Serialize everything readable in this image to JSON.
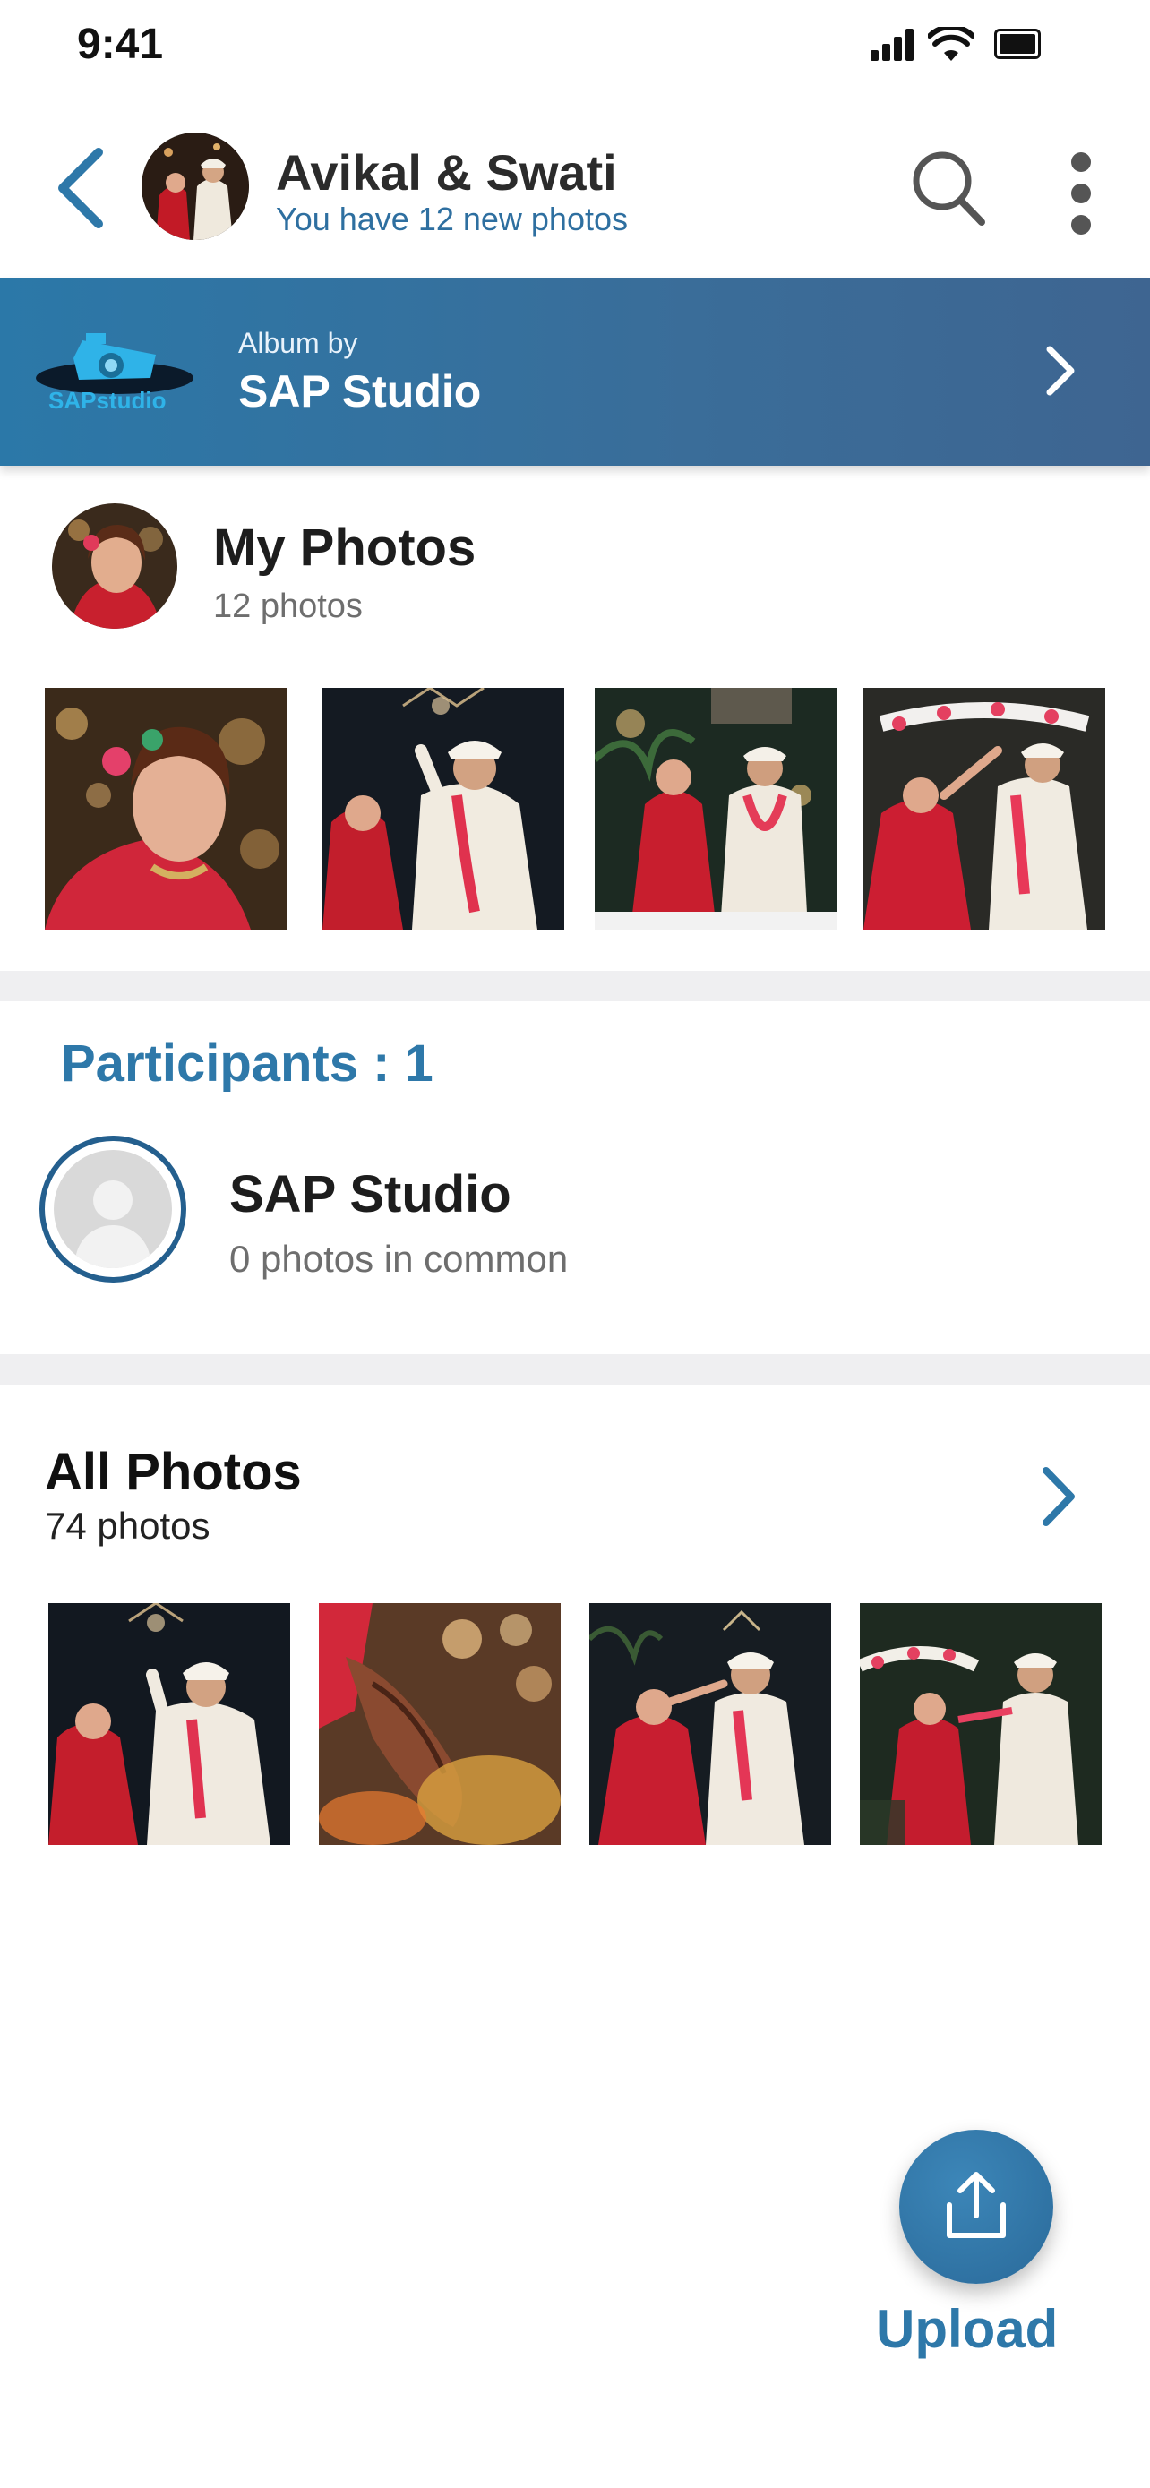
{
  "status_bar": {
    "time": "9:41"
  },
  "header": {
    "title": "Avikal & Swati",
    "subtitle": "You have 12 new photos"
  },
  "banner": {
    "caption": "Album by",
    "title": "SAP Studio",
    "logo_text": "SAPstudio"
  },
  "my_photos": {
    "title": "My Photos",
    "count": "12 photos",
    "thumbnails": [
      "bride-portrait",
      "couple-garland",
      "couple-stage",
      "couple-floral-arch"
    ]
  },
  "participants": {
    "title": "Participants : 1",
    "items": [
      {
        "name": "SAP Studio",
        "subtitle": "0 photos in common"
      }
    ]
  },
  "all_photos": {
    "title": "All Photos",
    "count": "74 photos",
    "thumbnails": [
      "couple-dance",
      "mehndi-hands",
      "couple-ritual",
      "couple-garden"
    ]
  },
  "upload": {
    "label": "Upload"
  },
  "colors": {
    "accent": "#2e78a9",
    "banner_start": "#2b78a8",
    "banner_end": "#3e6591",
    "divider": "#efeff1"
  }
}
